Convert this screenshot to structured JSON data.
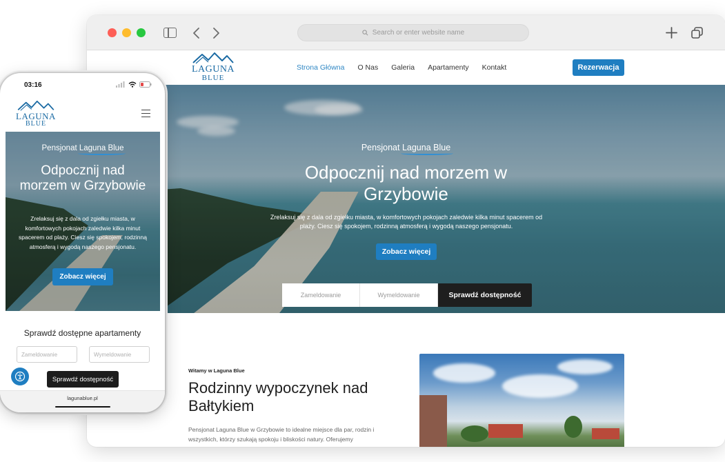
{
  "browser": {
    "url_placeholder": "Search or enter website name"
  },
  "site": {
    "logo_line1": "LAGUNA",
    "logo_line2": "BLUE",
    "nav": [
      "Strona Główna",
      "O Nas",
      "Galeria",
      "Apartamenty",
      "Kontakt"
    ],
    "nav_active_index": 0,
    "reserve_label": "Rezerwacja",
    "accent_color": "#1f7ec1"
  },
  "hero": {
    "kicker_prefix": "Pensjonat",
    "kicker_brand": "Laguna Blue",
    "title": "Odpocznij nad morzem w Grzybowie",
    "description": "Zrelaksuj się z dala od zgiełku miasta, w komfortowych pokojach zaledwie kilka minut spacerem od plaży. Ciesz się spokojem, rodzinną atmosferą i wygodą naszego pensjonatu.",
    "cta_label": "Zobacz więcej",
    "checkin_placeholder": "Zameldowanie",
    "checkout_placeholder": "Wymeldowanie",
    "check_label": "Sprawdź dostępność"
  },
  "about": {
    "kicker": "Witamy w Laguna Blue",
    "title": "Rodzinny wypoczynek nad Bałtykiem",
    "text": "Pensjonat Laguna Blue w Grzybowie to idealne miejsce dla par, rodzin i wszystkich, którzy szukają spokoju i bliskości natury. Oferujemy komfortowe noclegi, przyjazną atmosferę i"
  },
  "mobile": {
    "time": "03:16",
    "check_title": "Sprawdź dostępne apartamenty",
    "checkin_placeholder": "Zameldowanie",
    "checkout_placeholder": "Wymeldowanie",
    "check_label": "Sprawdź dostępność",
    "url": "lagunablue.pl"
  }
}
